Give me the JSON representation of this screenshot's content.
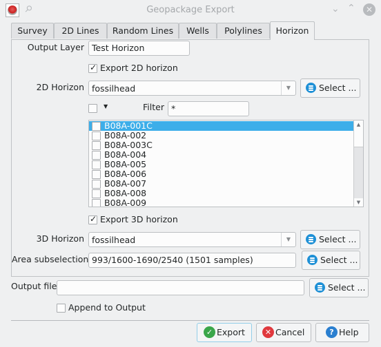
{
  "window": {
    "title": "Geopackage Export",
    "icons": {
      "app": "app-logo-icon",
      "pin": "pin-icon",
      "minimize": "chevron-down-icon",
      "maximize": "chevron-up-icon",
      "close": "close-icon"
    }
  },
  "tabs": [
    {
      "label": "Survey",
      "active": false
    },
    {
      "label": "2D Lines",
      "active": false
    },
    {
      "label": "Random Lines",
      "active": false
    },
    {
      "label": "Wells",
      "active": false
    },
    {
      "label": "Polylines",
      "active": false
    },
    {
      "label": "Horizon",
      "active": true
    }
  ],
  "horizon": {
    "output_layer_label": "Output Layer",
    "output_layer_value": "Test Horizon",
    "export_2d_label": "Export 2D horizon",
    "export_2d_checked": true,
    "horizon_2d_label": "2D Horizon",
    "horizon_2d_value": "fossilhead",
    "filter_label": "Filter",
    "filter_value": "*",
    "select_all_checked": false,
    "lines": [
      {
        "name": "B08A-001C",
        "checked": false,
        "selected": true
      },
      {
        "name": "B08A-002",
        "checked": false,
        "selected": false
      },
      {
        "name": "B08A-003C",
        "checked": false,
        "selected": false
      },
      {
        "name": "B08A-004",
        "checked": false,
        "selected": false
      },
      {
        "name": "B08A-005",
        "checked": false,
        "selected": false
      },
      {
        "name": "B08A-006",
        "checked": false,
        "selected": false
      },
      {
        "name": "B08A-007",
        "checked": false,
        "selected": false
      },
      {
        "name": "B08A-008",
        "checked": false,
        "selected": false
      },
      {
        "name": "B08A-009",
        "checked": false,
        "selected": false
      }
    ],
    "export_3d_label": "Export 3D horizon",
    "export_3d_checked": true,
    "horizon_3d_label": "3D Horizon",
    "horizon_3d_value": "fossilhead",
    "area_label": "Area subselection",
    "area_value": "993/1600-1690/2540 (1501 samples)",
    "select_label": "Select ..."
  },
  "output": {
    "file_label": "Output file",
    "file_value": "",
    "select_label": "Select ...",
    "append_label": "Append to Output",
    "append_checked": false
  },
  "footer": {
    "export_label": "Export",
    "cancel_label": "Cancel",
    "help_label": "Help"
  },
  "colors": {
    "accent": "#3daee9",
    "select_icon": "#1e90d6",
    "export_icon": "#3aa64a",
    "cancel_icon": "#e0393e",
    "help_icon": "#2a7fd0"
  }
}
